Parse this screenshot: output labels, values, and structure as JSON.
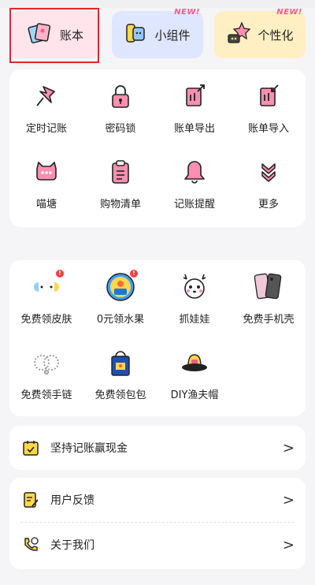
{
  "top_cards": [
    {
      "label": "账本",
      "badge": ""
    },
    {
      "label": "小组件",
      "badge": "NEW!"
    },
    {
      "label": "个性化",
      "badge": "NEW!"
    }
  ],
  "tools": [
    {
      "label": "定时记账",
      "icon": "pin-icon"
    },
    {
      "label": "密码锁",
      "icon": "lock-icon"
    },
    {
      "label": "账单导出",
      "icon": "export-icon"
    },
    {
      "label": "账单导入",
      "icon": "import-icon"
    },
    {
      "label": "喵塘",
      "icon": "cat-chat-icon"
    },
    {
      "label": "购物清单",
      "icon": "clipboard-icon"
    },
    {
      "label": "记账提醒",
      "icon": "bell-icon"
    },
    {
      "label": "更多",
      "icon": "double-chevron-down-icon"
    }
  ],
  "rewards": [
    {
      "label": "免费领皮肤",
      "icon": "skin-icon",
      "badge": "!"
    },
    {
      "label": "0元领水果",
      "icon": "fruit-icon",
      "badge": "!"
    },
    {
      "label": "抓娃娃",
      "icon": "deer-doll-icon",
      "badge": ""
    },
    {
      "label": "免费手机壳",
      "icon": "phone-case-icon",
      "badge": ""
    },
    {
      "label": "免费领手链",
      "icon": "bracelet-icon",
      "badge": ""
    },
    {
      "label": "免费领包包",
      "icon": "tote-bag-icon",
      "badge": ""
    },
    {
      "label": "DIY渔夫帽",
      "icon": "bucket-hat-icon",
      "badge": ""
    }
  ],
  "checkin": {
    "label": "坚持记账赢现金"
  },
  "menu": [
    {
      "label": "用户反馈",
      "icon": "feedback-icon"
    },
    {
      "label": "关于我们",
      "icon": "phone-chat-icon"
    }
  ],
  "chevron": ">"
}
